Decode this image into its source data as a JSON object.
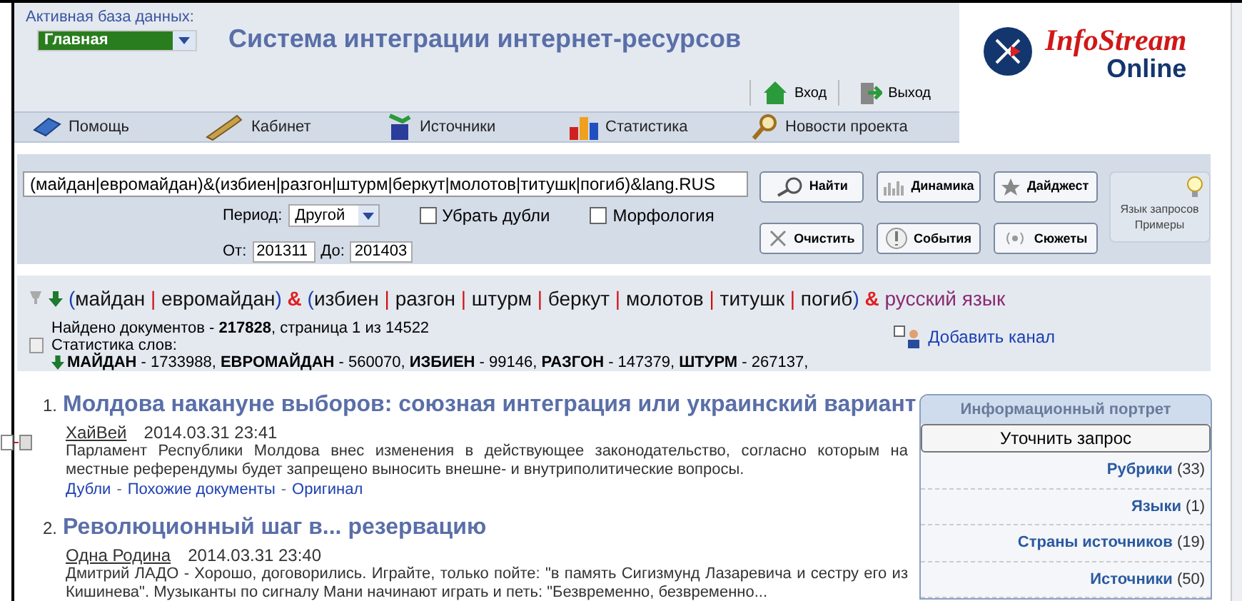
{
  "header": {
    "db_label": "Активная база данных:",
    "db_value": "Главная",
    "title": "Система интеграции интернет-ресурсов",
    "login": "Вход",
    "logout": "Выход",
    "logo_main": "InfoStream",
    "logo_sub": "Online"
  },
  "nav": [
    {
      "label": "Помощь"
    },
    {
      "label": "Кабинет"
    },
    {
      "label": "Источники"
    },
    {
      "label": "Статистика"
    },
    {
      "label": "Новости проекта"
    }
  ],
  "search": {
    "query": "(майдан|евромайдан)&(избиен|разгон|штурм|беркут|молотов|титушк|погиб)&lang.RUS",
    "period_label": "Период:",
    "period_value": "Другой",
    "options": [
      {
        "label": "Убрать дубли",
        "checked": false
      },
      {
        "label": "Морфология",
        "checked": false
      }
    ],
    "from_label": "От:",
    "from_value": "201311",
    "to_label": "До:",
    "to_value": "201403",
    "buttons": [
      {
        "label": "Найти"
      },
      {
        "label": "Динамика"
      },
      {
        "label": "Дайджест"
      },
      {
        "label": "Очистить"
      },
      {
        "label": "События"
      },
      {
        "label": "Сюжеты"
      }
    ],
    "help": [
      "Язык запросов",
      "Примеры"
    ]
  },
  "results": {
    "query_tokens": [
      {
        "text": "(",
        "kind": "paren"
      },
      {
        "text": "майдан",
        "kind": "word"
      },
      {
        "text": "|",
        "kind": "or"
      },
      {
        "text": "евромайдан",
        "kind": "word"
      },
      {
        "text": ")",
        "kind": "paren"
      },
      {
        "text": "&",
        "kind": "and"
      },
      {
        "text": "(",
        "kind": "paren"
      },
      {
        "text": "избиен",
        "kind": "word"
      },
      {
        "text": "|",
        "kind": "or"
      },
      {
        "text": "разгон",
        "kind": "word"
      },
      {
        "text": "|",
        "kind": "or"
      },
      {
        "text": "штурм",
        "kind": "word"
      },
      {
        "text": "|",
        "kind": "or"
      },
      {
        "text": "беркут",
        "kind": "word"
      },
      {
        "text": "|",
        "kind": "or"
      },
      {
        "text": "молотов",
        "kind": "word"
      },
      {
        "text": "|",
        "kind": "or"
      },
      {
        "text": "титушк",
        "kind": "word"
      },
      {
        "text": "|",
        "kind": "or"
      },
      {
        "text": "погиб",
        "kind": "word"
      },
      {
        "text": ")",
        "kind": "paren"
      },
      {
        "text": "&",
        "kind": "and"
      },
      {
        "text": "русский язык",
        "kind": "lang"
      }
    ],
    "found": "Найдено документов - **217828**, страница 1 из 14522",
    "stats_label": "Статистика слов:",
    "stats": "**МАЙДАН** - 1733988, **ЕВРОМАЙДАН** - 560070, **ИЗБИЕН** - 99146, **РАЗГОН** - 147379, **ШТУРМ** - 267137,",
    "add_channel": "Добавить канал"
  },
  "articles": [
    {
      "num": "1.",
      "title": "Молдова накануне выборов: союзная интеграция или украинский вариант",
      "source": "ХайВей",
      "date": "2014.03.31 23:41",
      "text": "Парламент Республики Молдова внес изменения в действующее законодательство, согласно которым на местные референдумы будет запрещено выносить внешне- и внутриполитические вопросы.",
      "links": [
        {
          "text": "Дубли",
          "kind": "link"
        },
        {
          "text": "-",
          "kind": "sep"
        },
        {
          "text": "Похожие документы",
          "kind": "link"
        },
        {
          "text": "-",
          "kind": "sep"
        },
        {
          "text": "Оригинал",
          "kind": "link"
        }
      ]
    },
    {
      "num": "2.",
      "title": "Революционный шаг в... резервацию",
      "source": "Одна Родина",
      "date": "2014.03.31 23:40",
      "text": "Дмитрий ЛАДО - Хорошо, договорились. Играйте, только пойте: \"в память Сигизмунд Лазаревича и сестру его из Кишинева\". Музыканты по сигналу Мани начинают играть и петь: \"Безвременно, безвременно..."
    }
  ],
  "portrait": {
    "title": "Информационный портрет",
    "refine": "Уточнить запрос",
    "items": [
      {
        "label": "Рубрики",
        "count": "(33)"
      },
      {
        "label": "Языки",
        "count": "(1)"
      },
      {
        "label": "Страны источников",
        "count": "(19)"
      },
      {
        "label": "Источники",
        "count": "(50)"
      }
    ]
  }
}
